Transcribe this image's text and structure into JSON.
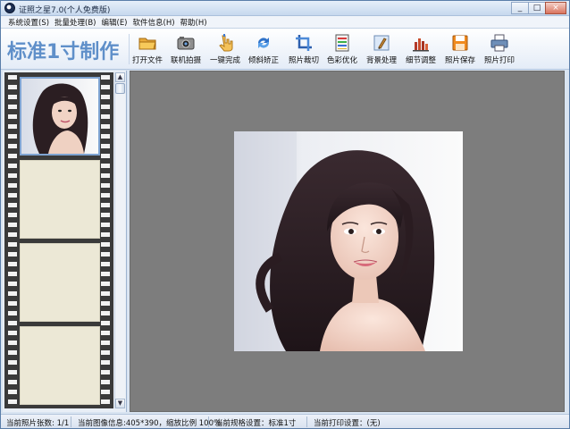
{
  "window": {
    "title": "证照之星7.0(个人免费版)"
  },
  "window_controls": {
    "minimize": "_",
    "maximize": "□",
    "close": "×"
  },
  "menu": [
    "系统设置(S)",
    "批量处理(B)",
    "编辑(E)",
    "软件信息(H)",
    "帮助(H)"
  ],
  "toolbar": {
    "brand": "标准1寸制作",
    "tools": [
      "打开文件",
      "联机拍摄",
      "一键完成",
      "倾斜矫正",
      "照片裁切",
      "色彩优化",
      "背景处理",
      "细节调整",
      "照片保存",
      "照片打印"
    ]
  },
  "scrollbar": {
    "up": "▲",
    "down": "▼"
  },
  "status": {
    "count": "当前照片张数: 1/1",
    "image_info": "当前图像信息:405*390，缩放比例 100%",
    "spec": "当前规格设置：标准1寸",
    "print": "当前打印设置：(无)"
  },
  "colors": {
    "brand": "#5f8fc9",
    "canvas": "#7d7d7d",
    "film": "#3a3a3a"
  },
  "icons": [
    "folder-open-icon",
    "camera-icon",
    "hand-click-icon",
    "rotate-arrows-icon",
    "crop-icon",
    "color-palette-icon",
    "brush-icon",
    "bar-chart-icon",
    "floppy-save-icon",
    "printer-icon"
  ]
}
